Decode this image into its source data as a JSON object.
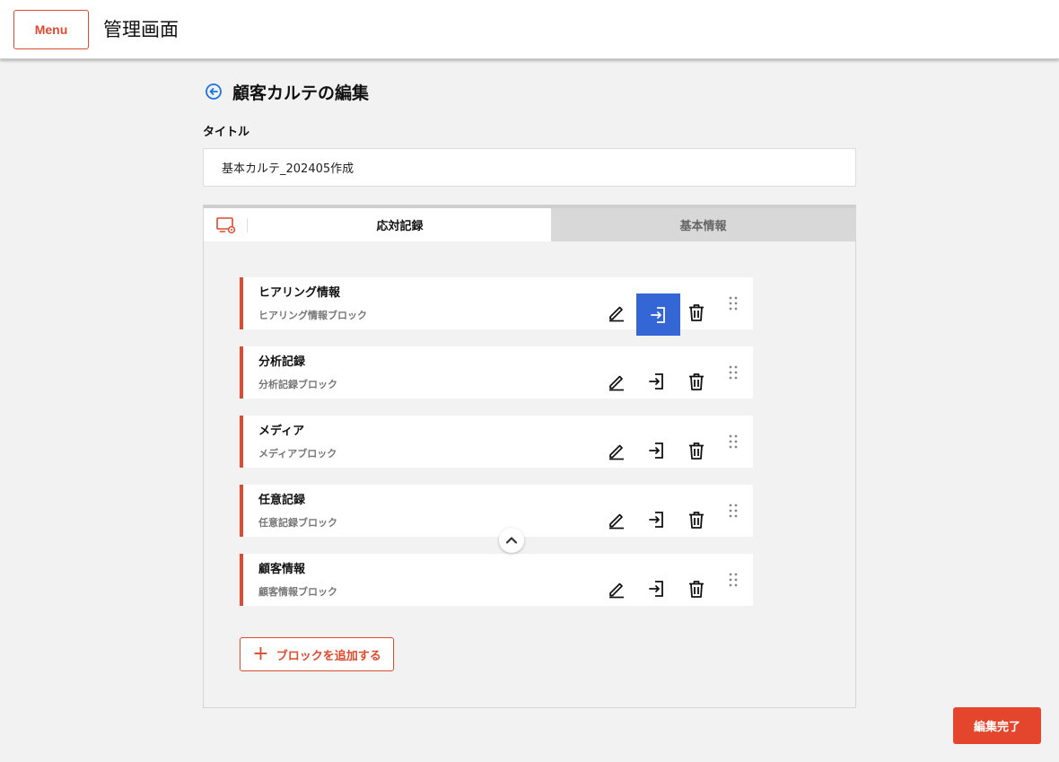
{
  "header": {
    "menu_label": "Menu",
    "app_title": "管理画面"
  },
  "page": {
    "title": "顧客カルテの編集",
    "title_label": "タイトル",
    "title_value": "基本カルテ_202405作成"
  },
  "tabs": [
    {
      "label": "応対記録",
      "active": true
    },
    {
      "label": "基本情報",
      "active": false
    }
  ],
  "blocks": [
    {
      "title": "ヒアリング情報",
      "subtitle": "ヒアリング情報ブロック"
    },
    {
      "title": "分析記録",
      "subtitle": "分析記録ブロック"
    },
    {
      "title": "メディア",
      "subtitle": "メディアブロック"
    },
    {
      "title": "任意記録",
      "subtitle": "任意記録ブロック"
    },
    {
      "title": "顧客情報",
      "subtitle": "顧客情報ブロック"
    }
  ],
  "actions": {
    "add_block_label": "ブロックを追加する",
    "add_block_icon": "+",
    "done_label": "編集完了"
  },
  "icons": {
    "back": "back-arrow-circle-icon",
    "settings_tab": "screen-settings-icon",
    "edit": "pencil-icon",
    "move": "move-in-icon",
    "delete": "trash-icon",
    "drag": "drag-handle-icon",
    "collapse": "chevron-up-icon"
  },
  "colors": {
    "accent": "#e04a2f",
    "highlight": "#3466d6",
    "back_icon": "#1a73e8"
  }
}
